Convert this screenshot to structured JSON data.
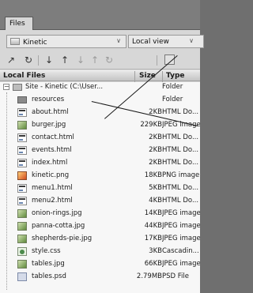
{
  "panel": {
    "tab_label": "Files",
    "site_select": "Kinetic",
    "view_select": "Local view"
  },
  "toolbar": {
    "icons": [
      "connect-icon",
      "refresh-icon",
      "get-icon",
      "put-icon",
      "check-out-icon",
      "check-in-icon",
      "sync-icon",
      "expand-icon"
    ]
  },
  "header": {
    "col_name": "Local Files",
    "col_size": "Size",
    "col_type": "Type"
  },
  "rows": [
    {
      "name": "Site - Kinetic (C:\\User...",
      "size": "",
      "type": "Folder",
      "icon": "site-icon"
    },
    {
      "name": "resources",
      "size": "",
      "type": "Folder",
      "icon": "folder-icon"
    },
    {
      "name": "about.html",
      "size": "2KB",
      "type": "HTML Do...",
      "icon": "html-file-icon"
    },
    {
      "name": "burger.jpg",
      "size": "229KB",
      "type": "JPEG image",
      "icon": "jpeg-file-icon"
    },
    {
      "name": "contact.html",
      "size": "2KB",
      "type": "HTML Do...",
      "icon": "html-file-icon"
    },
    {
      "name": "events.html",
      "size": "2KB",
      "type": "HTML Do...",
      "icon": "html-file-icon"
    },
    {
      "name": "index.html",
      "size": "2KB",
      "type": "HTML Do...",
      "icon": "html-file-icon"
    },
    {
      "name": "kinetic.png",
      "size": "18KB",
      "type": "PNG image",
      "icon": "png-file-icon"
    },
    {
      "name": "menu1.html",
      "size": "5KB",
      "type": "HTML Do...",
      "icon": "html-file-icon"
    },
    {
      "name": "menu2.html",
      "size": "4KB",
      "type": "HTML Do...",
      "icon": "html-file-icon"
    },
    {
      "name": "onion-rings.jpg",
      "size": "14KB",
      "type": "JPEG image",
      "icon": "jpeg-file-icon"
    },
    {
      "name": "panna-cotta.jpg",
      "size": "44KB",
      "type": "JPEG image",
      "icon": "jpeg-file-icon"
    },
    {
      "name": "shepherds-pie.jpg",
      "size": "17KB",
      "type": "JPEG image",
      "icon": "jpeg-file-icon"
    },
    {
      "name": "style.css",
      "size": "3KB",
      "type": "Cascadin...",
      "icon": "css-file-icon"
    },
    {
      "name": "tables.jpg",
      "size": "66KB",
      "type": "JPEG image",
      "icon": "jpeg-file-icon"
    },
    {
      "name": "tables.psd",
      "size": "2.79MB",
      "type": "PSD File",
      "icon": "psd-file-icon"
    }
  ]
}
